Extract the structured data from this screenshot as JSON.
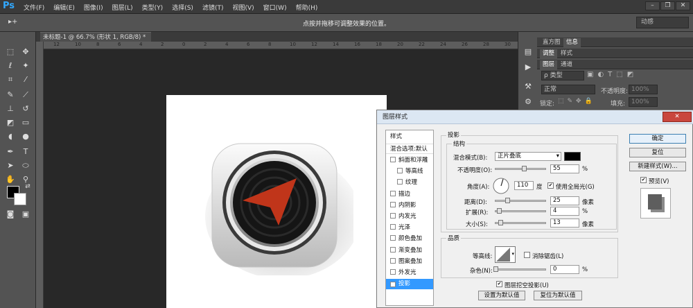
{
  "app": {
    "logo": "Ps"
  },
  "menubar": {
    "items": [
      "文件(F)",
      "编辑(E)",
      "图像(I)",
      "图层(L)",
      "类型(Y)",
      "选择(S)",
      "滤镜(T)",
      "视图(V)",
      "窗口(W)",
      "帮助(H)"
    ]
  },
  "window_controls": {
    "minimize": "–",
    "restore": "❐",
    "close": "✕"
  },
  "options_bar": {
    "hint": "点按并拖移可调整效果的位置。",
    "workspace": "动感",
    "tool_icon": "▸+"
  },
  "document": {
    "tab": "未标题-1 @ 66.7% (形状 1, RGB/8) *",
    "tab_close": "×",
    "ruler_marks": [
      "12",
      "10",
      "8",
      "6",
      "4",
      "2",
      "0",
      "2",
      "4",
      "6",
      "8",
      "10",
      "12",
      "14",
      "16",
      "18",
      "20",
      "22",
      "24",
      "26",
      "28",
      "30"
    ]
  },
  "right_panel": {
    "tabs_top": [
      "直方图",
      "信息"
    ],
    "tabs_mid": [
      "调整",
      "样式"
    ],
    "tabs_layers": [
      "图层",
      "通道"
    ],
    "filter_kind": "ρ 类型",
    "blend_mode": "正常",
    "opacity_label": "不透明度:",
    "opacity_value": "100%",
    "lock_label": "锁定:",
    "fill_label": "填充:",
    "fill_value": "100%"
  },
  "dialog": {
    "title": "图层样式",
    "style_header": "样式",
    "blend_defaults": "混合选项:默认",
    "items": [
      {
        "label": "斜面和浮雕",
        "checked": false,
        "indent": false
      },
      {
        "label": "等高线",
        "checked": false,
        "indent": true
      },
      {
        "label": "纹理",
        "checked": false,
        "indent": true
      },
      {
        "label": "描边",
        "checked": false,
        "indent": false
      },
      {
        "label": "内阴影",
        "checked": false,
        "indent": false
      },
      {
        "label": "内发光",
        "checked": false,
        "indent": false
      },
      {
        "label": "光泽",
        "checked": false,
        "indent": false
      },
      {
        "label": "颜色叠加",
        "checked": false,
        "indent": false
      },
      {
        "label": "渐变叠加",
        "checked": false,
        "indent": false
      },
      {
        "label": "图案叠加",
        "checked": false,
        "indent": false
      },
      {
        "label": "外发光",
        "checked": false,
        "indent": false
      },
      {
        "label": "投影",
        "checked": true,
        "indent": false
      }
    ],
    "section_title": "投影",
    "structure_title": "结构",
    "blend_mode_label": "混合模式(B):",
    "blend_mode_value": "正片叠底",
    "shadow_color": "#000000",
    "opacity_label": "不透明度(O):",
    "opacity_value": "55",
    "opacity_unit": "%",
    "angle_label": "角度(A):",
    "angle_value": "110",
    "angle_unit": "度",
    "global_light_label": "使用全局光(G)",
    "global_light_checked": true,
    "distance_label": "距离(D):",
    "distance_value": "25",
    "distance_unit": "像素",
    "spread_label": "扩展(R):",
    "spread_value": "4",
    "spread_unit": "%",
    "size_label": "大小(S):",
    "size_value": "13",
    "size_unit": "像素",
    "quality_title": "品质",
    "contour_label": "等高线:",
    "antialias_label": "消除锯齿(L)",
    "noise_label": "杂色(N):",
    "noise_value": "0",
    "noise_unit": "%",
    "knockout_label": "图层挖空投影(U)",
    "make_default": "设置为默认值",
    "reset_default": "复位为默认值",
    "ok": "确定",
    "reset": "复位",
    "new_style": "新建样式(W)...",
    "preview_label": "预览(V)",
    "preview_checked": true
  }
}
